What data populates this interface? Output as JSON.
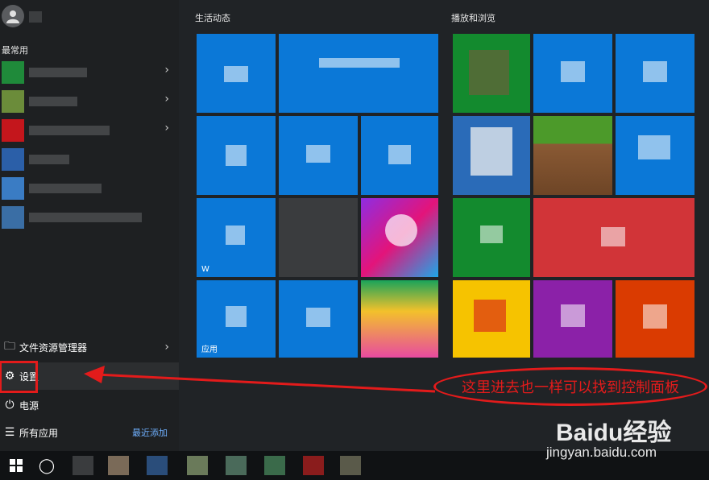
{
  "start_menu": {
    "most_used_title": "最常用",
    "life_title": "生活动态",
    "play_title": "播放和浏览",
    "file_explorer_label": "文件资源管理器",
    "settings_label": "设置",
    "power_label": "电源",
    "all_apps_label": "所有应用",
    "recently_added_label": "最近添加",
    "tile_label_app": "应用",
    "tile_label_w": "W"
  },
  "annotation": {
    "text": "这里进去也一样可以找到控制面板",
    "color": "#e31b1b"
  },
  "watermark": {
    "logo_text": "Baidu经验",
    "url": "jingyan.baidu.com"
  },
  "colors": {
    "tile_blue": "#0b78d7",
    "tile_green": "#138a2e",
    "tile_red": "#d13438",
    "tile_yellow": "#f6c300",
    "tile_purple": "#8b21a8",
    "tile_orange": "#da3b01"
  },
  "icons": {
    "settings": "gear-icon",
    "power": "power-icon",
    "file_explorer": "folder-icon",
    "all_apps": "list-icon",
    "start": "windows-logo-icon",
    "search": "cortana-icon"
  }
}
